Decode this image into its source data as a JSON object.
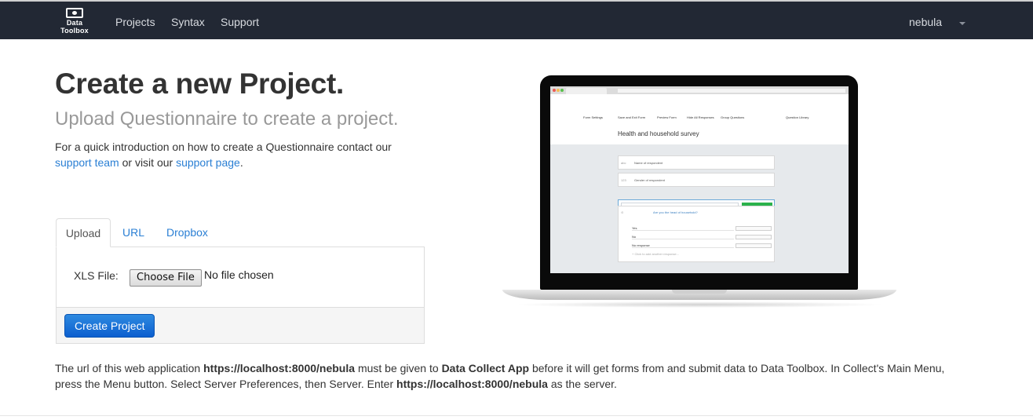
{
  "navbar": {
    "brand": {
      "line1": "Data",
      "line2": "Toolbox",
      "icon": "monitor-icon"
    },
    "links": [
      "Projects",
      "Syntax",
      "Support"
    ],
    "user": "nebula"
  },
  "header": {
    "title": "Create a new Project.",
    "subtitle": "Upload Questionnaire to create a project.",
    "intro_prefix": "For a quick introduction on how to create a Questionnaire contact our",
    "support_team_link": "support team",
    "intro_middle": "or visit our",
    "support_page_link": "support page",
    "intro_suffix": "."
  },
  "tabs": [
    "Upload",
    "URL",
    "Dropbox"
  ],
  "upload": {
    "file_label": "XLS File:",
    "choose_button": "Choose File",
    "file_status": "No file chosen",
    "submit_button": "Create Project"
  },
  "illustration": {
    "toolbar": [
      "Form Settings",
      "Save and Exit Form",
      "Preview Form",
      "Hide All Responses",
      "Group Questions",
      "Question Library"
    ],
    "survey_title": "Health and household survey",
    "questions": [
      {
        "icon": "abc",
        "text": "Name of respondent"
      },
      {
        "icon": "123",
        "text": "Gender of respondent"
      }
    ],
    "input_placeholder": "How old are you?",
    "add_question_button": "+ Add Question",
    "select_question": "Are you the head of household?",
    "options": [
      "Yes",
      "No",
      "No response"
    ],
    "add_option_hint": "+ Click to add another response..."
  },
  "footer_note": {
    "part1": "The url of this web application",
    "url1": "https://localhost:8000/nebula",
    "part2": "must be given to",
    "app": "Data Collect App",
    "part3": "before it will get forms from and submit data to Data Toolbox. In Collect's Main Menu, press the Menu button. Select Server Preferences, then Server. Enter",
    "url2": "https://localhost:8000/nebula",
    "part4": "as the server."
  },
  "colors": {
    "navbar_bg": "#222834",
    "link": "#2a7fd4",
    "primary_button": "#1a6fd8",
    "subtitle": "#999999"
  }
}
